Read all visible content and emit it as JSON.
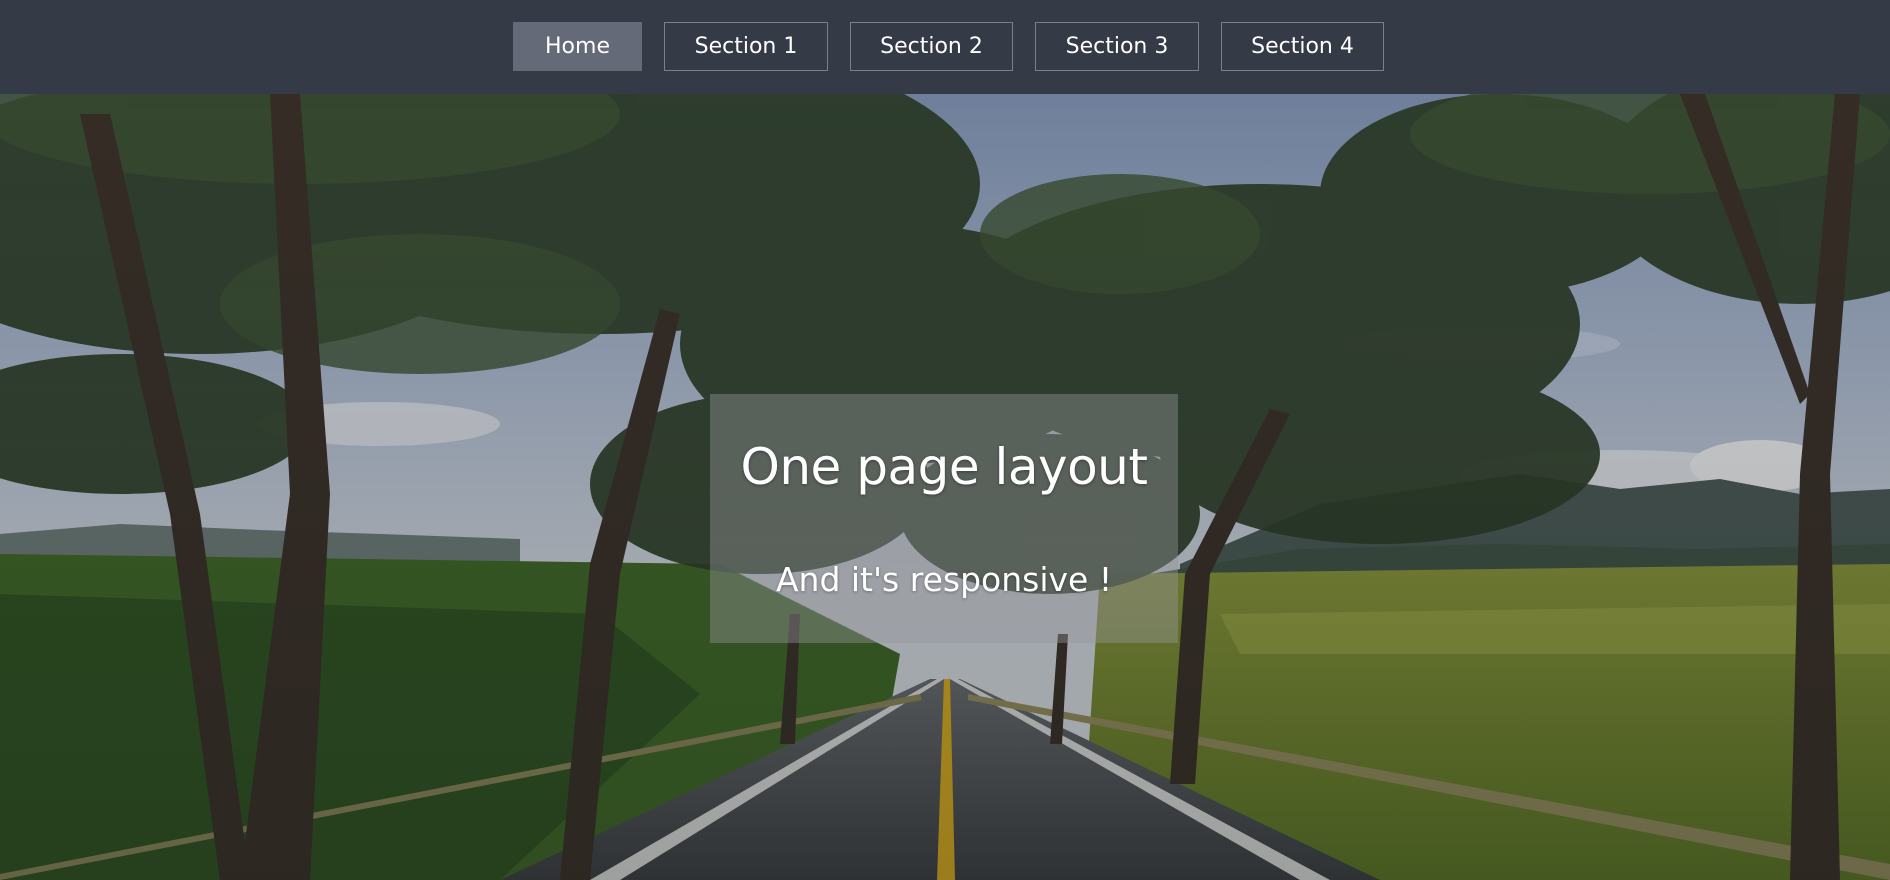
{
  "nav": {
    "items": [
      {
        "label": "Home",
        "active": true
      },
      {
        "label": "Section 1",
        "active": false
      },
      {
        "label": "Section 2",
        "active": false
      },
      {
        "label": "Section 3",
        "active": false
      },
      {
        "label": "Section 4",
        "active": false
      }
    ]
  },
  "hero": {
    "title": "One page layout",
    "subtitle": "And it's responsive !",
    "background_image": "tree-lined-road-photo"
  },
  "colors": {
    "navbar_bg": "#353a47",
    "nav_active_bg": "#656a78",
    "nav_border": "#7a7f8b",
    "text": "#ffffff"
  }
}
